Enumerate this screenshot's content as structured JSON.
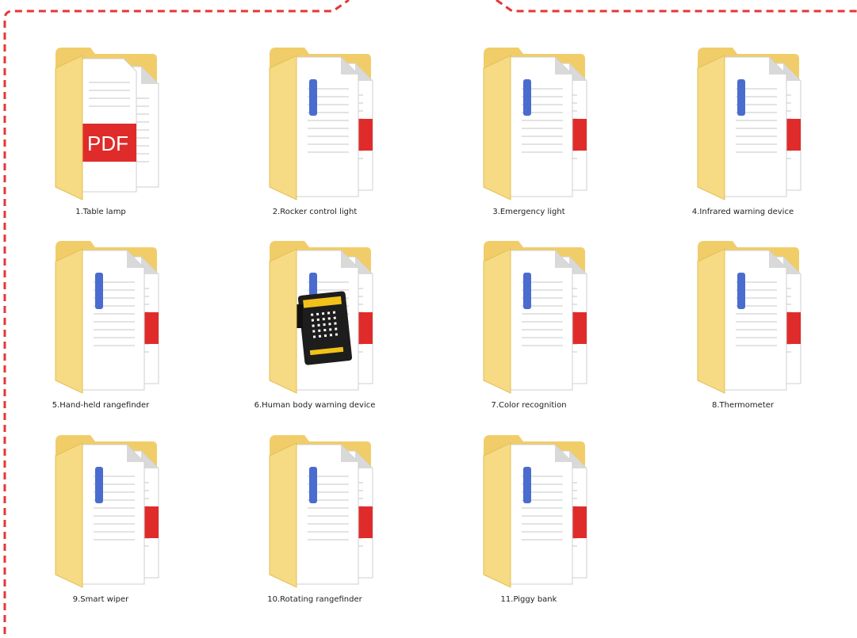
{
  "colors": {
    "frame_dash": "#e53636",
    "folder_back": "#f1cd6a",
    "folder_front": "#f6da84",
    "doc_paper": "#ffffff",
    "doc_blue": "#4a6ccf",
    "doc_red": "#e02b2b",
    "board_black": "#1d1d1d",
    "board_yellow": "#f2c21a"
  },
  "folders": [
    {
      "label": "1.Table lamp",
      "icon": "pdf-folder-icon",
      "badge_text": "PDF"
    },
    {
      "label": "2.Rocker control light",
      "icon": "document-folder-icon"
    },
    {
      "label": "3.Emergency light",
      "icon": "document-folder-icon"
    },
    {
      "label": "4.Infrared warning device",
      "icon": "document-folder-icon"
    },
    {
      "label": "5.Hand-held rangefinder",
      "icon": "document-folder-icon"
    },
    {
      "label": "6.Human body warning device",
      "icon": "microbit-folder-icon"
    },
    {
      "label": "7.Color recognition",
      "icon": "document-folder-icon"
    },
    {
      "label": "8.Thermometer",
      "icon": "document-folder-icon"
    },
    {
      "label": "9.Smart wiper",
      "icon": "document-folder-icon"
    },
    {
      "label": "10.Rotating rangefinder",
      "icon": "document-folder-icon"
    },
    {
      "label": "11.Piggy bank",
      "icon": "document-folder-icon"
    }
  ]
}
